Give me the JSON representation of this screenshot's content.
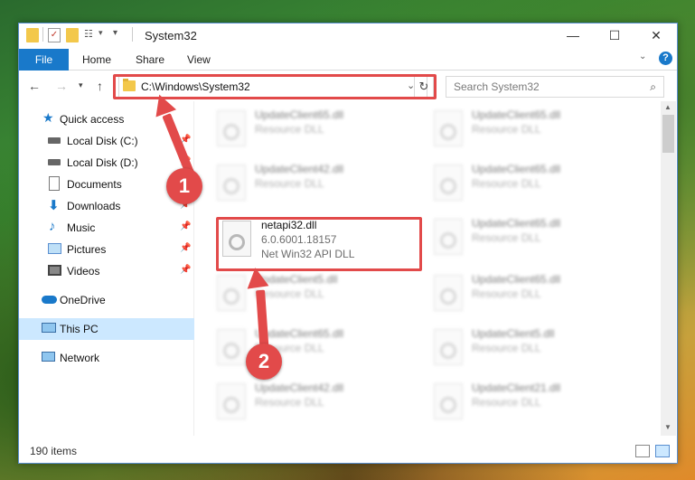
{
  "window": {
    "title": "System32"
  },
  "ribbon": {
    "tabs": [
      "File",
      "Home",
      "Share",
      "View"
    ]
  },
  "address": {
    "path": "C:\\Windows\\System32"
  },
  "search": {
    "placeholder": "Search System32"
  },
  "sidebar": {
    "items": [
      {
        "label": "Quick access",
        "icon": "star-icon",
        "pinned": false
      },
      {
        "label": "Local Disk (C:)",
        "icon": "drive-icon",
        "pinned": true
      },
      {
        "label": "Local Disk (D:)",
        "icon": "drive-icon",
        "pinned": true
      },
      {
        "label": "Documents",
        "icon": "documents-icon",
        "pinned": true
      },
      {
        "label": "Downloads",
        "icon": "download-icon",
        "pinned": true
      },
      {
        "label": "Music",
        "icon": "music-icon",
        "pinned": true
      },
      {
        "label": "Pictures",
        "icon": "pictures-icon",
        "pinned": true
      },
      {
        "label": "Videos",
        "icon": "videos-icon",
        "pinned": true
      },
      {
        "label": "OneDrive",
        "icon": "cloud-icon",
        "pinned": false
      },
      {
        "label": "This PC",
        "icon": "computer-icon",
        "pinned": false,
        "selected": true
      },
      {
        "label": "Network",
        "icon": "network-icon",
        "pinned": false
      }
    ]
  },
  "files": {
    "highlighted": {
      "name": "netapi32.dll",
      "version": "6.0.6001.18157",
      "description": "Net Win32 API DLL"
    },
    "left": [
      {
        "name": "UpdateClient65.dll",
        "type": "Resource DLL"
      },
      {
        "name": "UpdateClient42.dll",
        "type": "Resource DLL"
      },
      {
        "name": "UpdateClient5.dll",
        "type": "Resource DLL"
      },
      {
        "name": "UpdateClient65.dll",
        "type": "Resource DLL"
      },
      {
        "name": "UpdateClient42.dll",
        "type": "Resource DLL"
      }
    ],
    "right": [
      {
        "name": "UpdateClient65.dll",
        "type": "Resource DLL"
      },
      {
        "name": "UpdateClient65.dll",
        "type": "Resource DLL"
      },
      {
        "name": "UpdateClient65.dll",
        "type": "Resource DLL"
      },
      {
        "name": "UpdateClient65.dll",
        "type": "Resource DLL"
      },
      {
        "name": "UpdateClient5.dll",
        "type": "Resource DLL"
      },
      {
        "name": "UpdateClient21.dll",
        "type": "Resource DLL"
      }
    ]
  },
  "status": {
    "item_count": "190 items"
  },
  "callouts": {
    "step1": "1",
    "step2": "2"
  },
  "colors": {
    "accent": "#1979ca",
    "highlight": "#e24a4a",
    "selected": "#cce8ff"
  }
}
